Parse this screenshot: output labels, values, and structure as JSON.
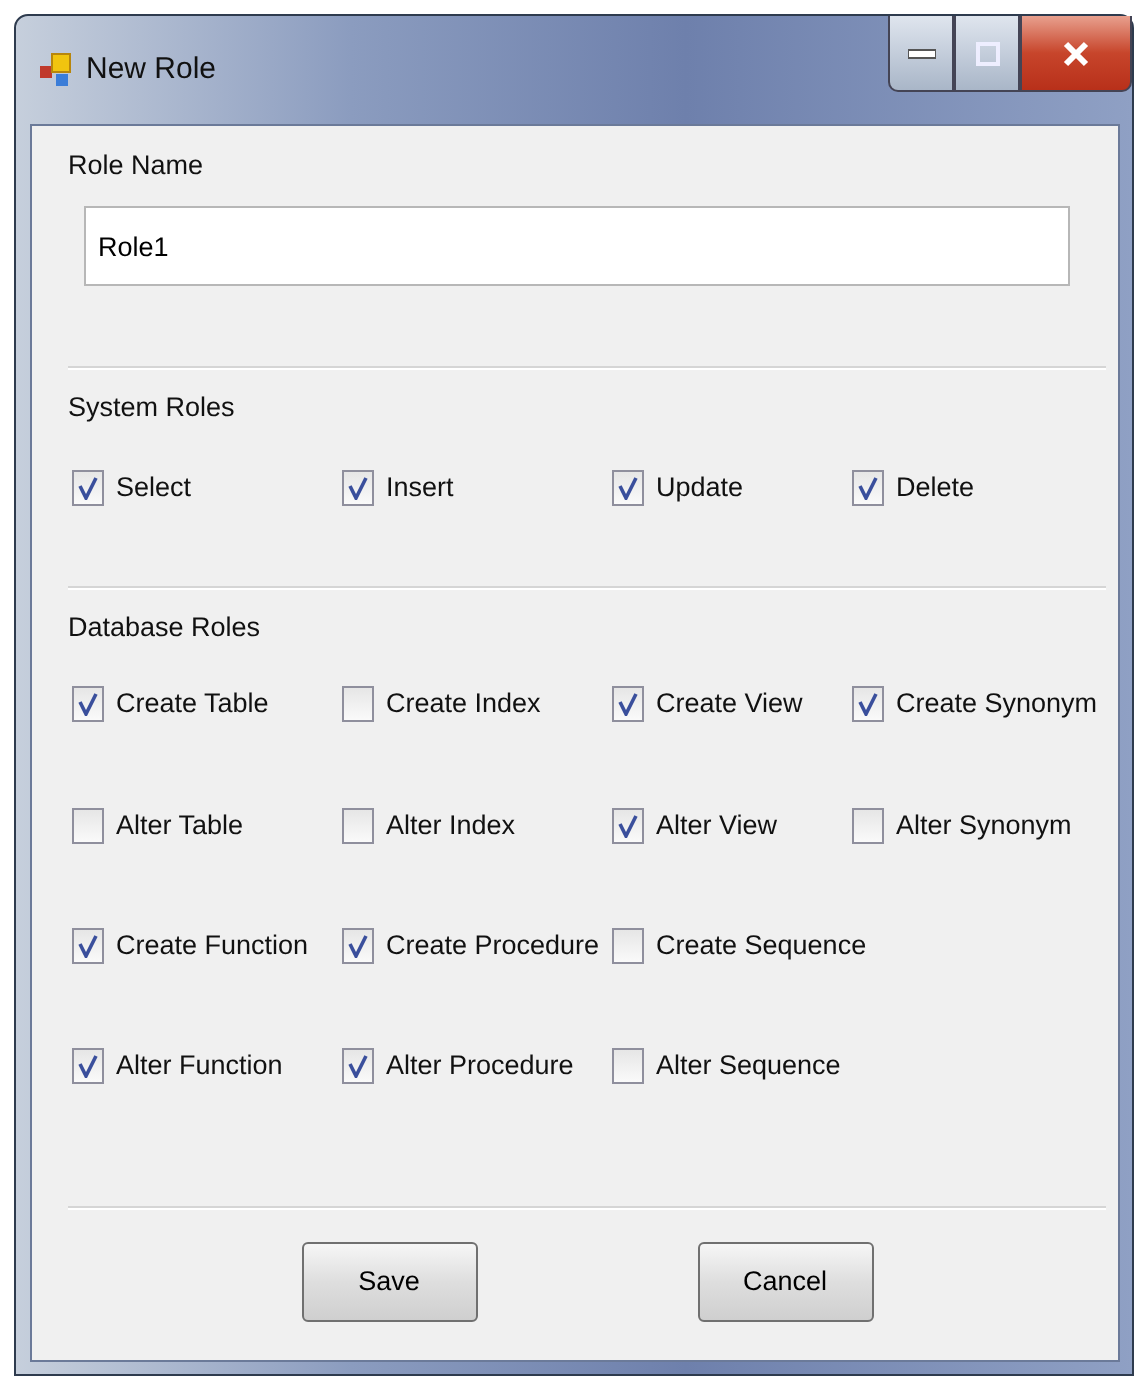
{
  "window": {
    "title": "New Role"
  },
  "role_name": {
    "label": "Role Name",
    "value": "Role1"
  },
  "system_roles": {
    "label": "System Roles",
    "items": [
      {
        "label": "Select",
        "checked": true
      },
      {
        "label": "Insert",
        "checked": true
      },
      {
        "label": "Update",
        "checked": true
      },
      {
        "label": "Delete",
        "checked": true
      }
    ]
  },
  "database_roles": {
    "label": "Database Roles",
    "rows": [
      [
        {
          "label": "Create Table",
          "checked": true
        },
        {
          "label": "Create Index",
          "checked": false
        },
        {
          "label": "Create View",
          "checked": true
        },
        {
          "label": "Create Synonym",
          "checked": true
        }
      ],
      [
        {
          "label": "Alter Table",
          "checked": false
        },
        {
          "label": "Alter Index",
          "checked": false
        },
        {
          "label": "Alter View",
          "checked": true
        },
        {
          "label": "Alter Synonym",
          "checked": false
        }
      ],
      [
        {
          "label": "Create Function",
          "checked": true
        },
        {
          "label": "Create Procedure",
          "checked": true
        },
        {
          "label": "Create Sequence",
          "checked": false
        }
      ],
      [
        {
          "label": "Alter Function",
          "checked": true
        },
        {
          "label": "Alter Procedure",
          "checked": true
        },
        {
          "label": "Alter Sequence",
          "checked": false
        }
      ]
    ]
  },
  "buttons": [
    {
      "label": "Save"
    },
    {
      "label": "Cancel"
    }
  ]
}
